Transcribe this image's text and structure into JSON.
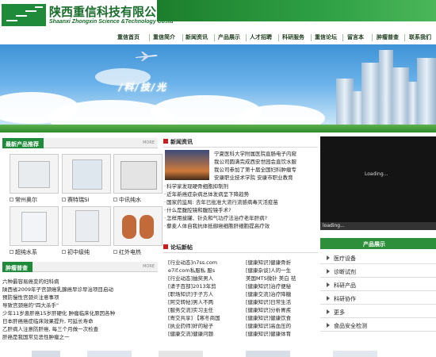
{
  "brand": {
    "cn": "陕西重信科技有限公司",
    "en": "Shaanxi Zhongxin Science &Technology Co.ltd"
  },
  "nav": [
    "重信首页",
    "重信简介",
    "新闻资讯",
    "产品展示",
    "人才招聘",
    "科研服务",
    "重信论坛",
    "留言本",
    "肿瘤普查",
    "联系我们"
  ],
  "banner": {
    "slogan": "/科/技/光"
  },
  "products": {
    "title": "最新产品推荐",
    "more": "MORE",
    "items": [
      "常州奥尔",
      "赛特瑞Si",
      "中讯纯水",
      "超纯水系",
      "初中级纯",
      "红外电热"
    ]
  },
  "news": {
    "title": "新闻资讯",
    "lines": [
      "宁夏医科大学附属医院直肠电子内窥",
      "我公司圆满完成西安世园会直饮水服",
      "我公司参加了第十届全国妇科肿瘤专",
      "安康职业技术学院 安康市职业教育",
      "科学家发现硬骨细胞抑制剂",
      "近年新癌症杂病总体发病呈下降趋势",
      "国家药监局: 去年已批准大流行流感病毒灭活疫苗",
      "什么是腹腔镜和腹腔镜手术?",
      "怎样用拔罐、针灸和气功疗法治疗老年肝病?",
      "藜麦人体自我抗体抵御癌细胞肝细胞提高疗效"
    ]
  },
  "video": {
    "loading": "Loading...",
    "status": "loading..."
  },
  "health": {
    "title": "肿瘤普查",
    "lines": [
      "六种最容易癌变的妇科病",
      "陕西省2009年子宫颈癌乳腺癌早诊早治项目启动",
      "预防慢性宫颈炎注意事项",
      "导致宫颈癌的\"四大杀手\"",
      "少年11岁患肝癌15岁肝硬化 肿瘤临床化原因各种",
      "日本肝癌癌症临床效果提升, 可延长寿命",
      "乙肝病人注意防肝癌, 每三个月做一次检查",
      "肝癌是我国常见恶性肿瘤之一"
    ]
  },
  "forum": {
    "title": "论坛新帖",
    "left": [
      "[行业动态]n7ss.com",
      "e7if.com私服私 服s",
      "[行业动态]抽奖男人",
      "[请子百部]2013年剪",
      "[职场知识]于子方人",
      "[阿交转帖]男人不两",
      "[服务交流]实习主任",
      "[寄交共享] 【寒冬商国",
      "[执业药师]好的秘子",
      "[健康交流]健康问题"
    ],
    "right": [
      "[健康知识]健康骨折",
      "[健康杂谈]人的一生",
      "美国MTS微针 美白 祛",
      "[健康知识]治疗便秘",
      "[健康交流]治疗降糖",
      "[健康知识]日常生活",
      "[健康知识]分析胃疾",
      "[健康知识]健康饮食",
      "[健康知识]高血压的",
      "[健康知识]健康体育"
    ]
  },
  "categories": {
    "title": "产品展示",
    "items": [
      "医疗设备",
      "诊断试剂",
      "科研产品",
      "科研协作",
      "更多",
      "食品安全检测"
    ]
  }
}
